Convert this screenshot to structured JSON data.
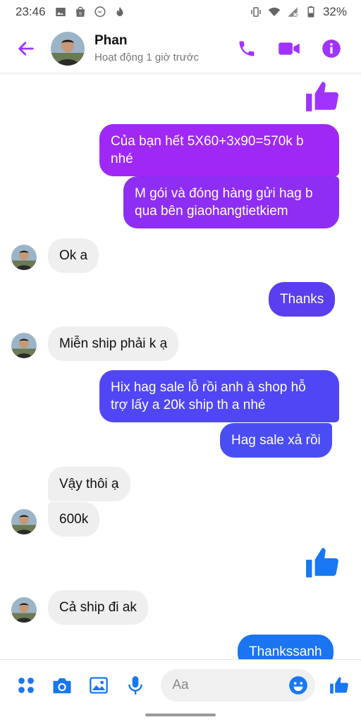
{
  "status_bar": {
    "time": "23:46",
    "battery": "32%",
    "left_icons": [
      "image-icon",
      "shop-icon",
      "messenger-icon",
      "fire-icon"
    ],
    "right_icons": [
      "vibrate-icon",
      "wifi-icon",
      "no-signal-icon",
      "battery-icon"
    ]
  },
  "header": {
    "name": "Phan",
    "status": "Hoạt động 1 giờ trước",
    "accent": "#a033ff"
  },
  "messages": [
    {
      "type": "like",
      "side": "out",
      "color": "#a033ff"
    },
    {
      "type": "text",
      "side": "out",
      "lines": [
        "Của bạn hết 5X60+3x90=570k b",
        "nhé"
      ],
      "color": "#a028f5"
    },
    {
      "type": "text",
      "side": "out",
      "lines": [
        "M gói và đóng hàng gửi hag b",
        "qua bên giaohangtietkiem"
      ],
      "color": "#8e2ef2"
    },
    {
      "type": "text",
      "side": "in",
      "lines": [
        "Ok a"
      ],
      "avatar": true
    },
    {
      "type": "text",
      "side": "out",
      "lines": [
        "Thanks"
      ],
      "color": "#5a3ef0"
    },
    {
      "type": "text",
      "side": "in",
      "lines": [
        "Miễn ship phải k ạ"
      ],
      "avatar": true
    },
    {
      "type": "text",
      "side": "out",
      "lines": [
        "Hix hag sale lỗ rồi anh à  shop hỗ",
        "trợ lấy a 20k ship th a nhé"
      ],
      "color": "#5146f5"
    },
    {
      "type": "text",
      "side": "out",
      "lines": [
        "Hag sale xả rồi"
      ],
      "color": "#4a4df4"
    },
    {
      "type": "text",
      "side": "in",
      "lines": [
        "Vậy thôi ạ"
      ],
      "avatar": false
    },
    {
      "type": "text",
      "side": "in",
      "lines": [
        "600k"
      ],
      "avatar": true
    },
    {
      "type": "like",
      "side": "out",
      "color": "#1877f2"
    },
    {
      "type": "text",
      "side": "in",
      "lines": [
        "Cả ship đi ak"
      ],
      "avatar": true
    },
    {
      "type": "text",
      "side": "out",
      "lines": [
        "Thankssanh"
      ],
      "color": "#1b74f0"
    }
  ],
  "composer": {
    "placeholder": "Aa",
    "accent": "#1877f2",
    "buttons": [
      "menu-icon",
      "camera-icon",
      "gallery-icon",
      "mic-icon"
    ]
  }
}
